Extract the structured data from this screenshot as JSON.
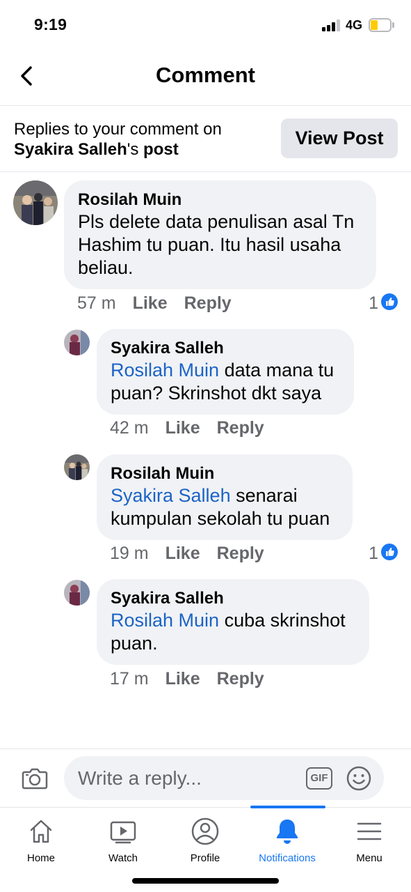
{
  "status_bar": {
    "time": "9:19",
    "network": "4G",
    "battery_color": "#ffcc00"
  },
  "header": {
    "title": "Comment"
  },
  "context": {
    "prefix": "Replies to your comment on",
    "post_owner": "Syakira Salleh",
    "possessive": "'s",
    "post_word": "post",
    "view_post_label": "View Post"
  },
  "comments": [
    {
      "author": "Rosilah Muin",
      "mention": "",
      "text": "Pls delete data penulisan asal Tn Hashim tu puan. Itu hasil usaha beliau.",
      "time": "57 m",
      "like_label": "Like",
      "reply_label": "Reply",
      "reactions": "1"
    },
    {
      "author": "Syakira Salleh",
      "mention": "Rosilah Muin",
      "text": " data mana tu puan? Skrinshot dkt saya",
      "time": "42 m",
      "like_label": "Like",
      "reply_label": "Reply",
      "reactions": ""
    },
    {
      "author": "Rosilah Muin",
      "mention": "Syakira Salleh",
      "text": " senarai kumpulan sekolah tu puan",
      "time": "19 m",
      "like_label": "Like",
      "reply_label": "Reply",
      "reactions": "1"
    },
    {
      "author": "Syakira Salleh",
      "mention": "Rosilah Muin",
      "text": " cuba skrinshot puan.",
      "time": "17 m",
      "like_label": "Like",
      "reply_label": "Reply",
      "reactions": ""
    }
  ],
  "reply_box": {
    "placeholder": "Write a reply...",
    "gif_label": "GIF"
  },
  "bottom_nav": {
    "items": [
      {
        "label": "Home",
        "icon": "home-icon"
      },
      {
        "label": "Watch",
        "icon": "watch-icon"
      },
      {
        "label": "Profile",
        "icon": "profile-icon"
      },
      {
        "label": "Notifications",
        "icon": "bell-icon"
      },
      {
        "label": "Menu",
        "icon": "menu-icon"
      }
    ],
    "active": "Notifications"
  },
  "colors": {
    "accent": "#1877f2",
    "mention": "#1c63c6",
    "bubble": "#f0f2f5",
    "muted": "#65676b"
  }
}
